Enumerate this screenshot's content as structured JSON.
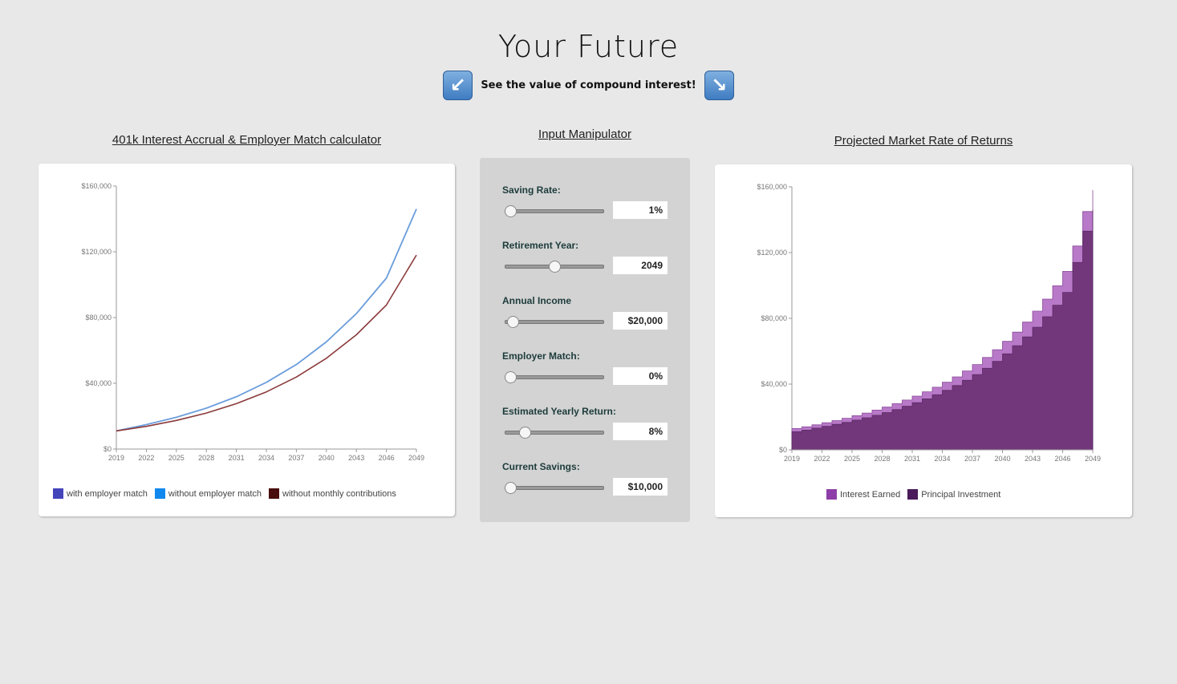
{
  "header": {
    "title": "Your Future",
    "subtitle": "See the value of compound interest!",
    "left_arrow_icon": "arrow-down-left-icon",
    "right_arrow_icon": "arrow-down-right-icon"
  },
  "sections": {
    "left_title": "401k Interest Accrual & Employer Match calculator",
    "middle_title": "Input Manipulator",
    "right_title": "Projected Market Rate of Returns"
  },
  "inputs": [
    {
      "label": "Saving Rate:",
      "value": "1%",
      "slider_fraction": 0.05
    },
    {
      "label": "Retirement Year:",
      "value": "2049",
      "slider_fraction": 0.5
    },
    {
      "label": "Annual Income",
      "value": "$20,000",
      "slider_fraction": 0.07
    },
    {
      "label": "Employer Match:",
      "value": "0%",
      "slider_fraction": 0.05
    },
    {
      "label": "Estimated Yearly Return:",
      "value": "8%",
      "slider_fraction": 0.2
    },
    {
      "label": "Current Savings:",
      "value": "$10,000",
      "slider_fraction": 0.05
    }
  ],
  "colors": {
    "with_match": "#4444bb",
    "without_match": "#1188ee",
    "without_contrib": "#4a0d0d",
    "line_without_match": "#6aa2dd",
    "line_without_contrib": "#8b3a3a",
    "interest_earned": "#8e3ea8",
    "principal": "#4a1a5a",
    "area_principal_fill": "#72377a",
    "area_interest_fill": "#b879c8"
  },
  "chart_data": [
    {
      "type": "line",
      "x": [
        2019,
        2022,
        2025,
        2028,
        2031,
        2034,
        2037,
        2040,
        2043,
        2046,
        2049
      ],
      "xticks": [
        "2019",
        "2022",
        "2025",
        "2028",
        "2031",
        "2034",
        "2037",
        "2040",
        "2043",
        "2046",
        "2049"
      ],
      "yticks": [
        "$0",
        "$40,000",
        "$80,000",
        "$120,000",
        "$160,000"
      ],
      "ylim": [
        0,
        160000
      ],
      "series": [
        {
          "name": "with employer match",
          "values": [
            11000,
            14900,
            19300,
            24900,
            31800,
            40600,
            51400,
            65200,
            82400,
            104000,
            146000
          ]
        },
        {
          "name": "without employer match",
          "values": [
            11000,
            14900,
            19300,
            24900,
            31800,
            40600,
            51400,
            65200,
            82400,
            104000,
            146000
          ]
        },
        {
          "name": "without monthly contributions",
          "values": [
            11000,
            13800,
            17400,
            21900,
            27600,
            34800,
            43800,
            55200,
            69500,
            87600,
            118000
          ]
        }
      ],
      "legend": [
        "with employer match",
        "without employer match",
        "without monthly contributions"
      ],
      "legend_position": "bottom"
    },
    {
      "type": "area",
      "x": [
        2019,
        2020,
        2021,
        2022,
        2023,
        2024,
        2025,
        2026,
        2027,
        2028,
        2029,
        2030,
        2031,
        2032,
        2033,
        2034,
        2035,
        2036,
        2037,
        2038,
        2039,
        2040,
        2041,
        2042,
        2043,
        2044,
        2045,
        2046,
        2047,
        2048,
        2049
      ],
      "xticks": [
        "2019",
        "2022",
        "2025",
        "2028",
        "2031",
        "2034",
        "2037",
        "2040",
        "2043",
        "2046",
        "2049"
      ],
      "yticks": [
        "$0",
        "$40,000",
        "$80,000",
        "$120,000",
        "$160,000"
      ],
      "ylim": [
        0,
        160000
      ],
      "series": [
        {
          "name": "Principal Investment",
          "values": [
            11000,
            12000,
            13200,
            14300,
            15500,
            16700,
            18100,
            19500,
            21000,
            22700,
            24500,
            26500,
            28700,
            31000,
            33500,
            36200,
            39100,
            42300,
            45800,
            49600,
            53800,
            58400,
            63300,
            68700,
            74600,
            81000,
            88000,
            95800,
            114000,
            133000,
            146000
          ]
        },
        {
          "name": "Interest Earned",
          "values": [
            13000,
            14000,
            15200,
            16500,
            17800,
            19200,
            20800,
            22400,
            24200,
            26000,
            28100,
            30300,
            32700,
            35300,
            38100,
            41100,
            44400,
            48000,
            51900,
            56200,
            60900,
            66000,
            71600,
            77700,
            84400,
            91700,
            99800,
            108600,
            124000,
            145000,
            158000
          ]
        }
      ],
      "legend": [
        "Interest Earned",
        "Principal Investment"
      ],
      "legend_position": "bottom"
    }
  ]
}
